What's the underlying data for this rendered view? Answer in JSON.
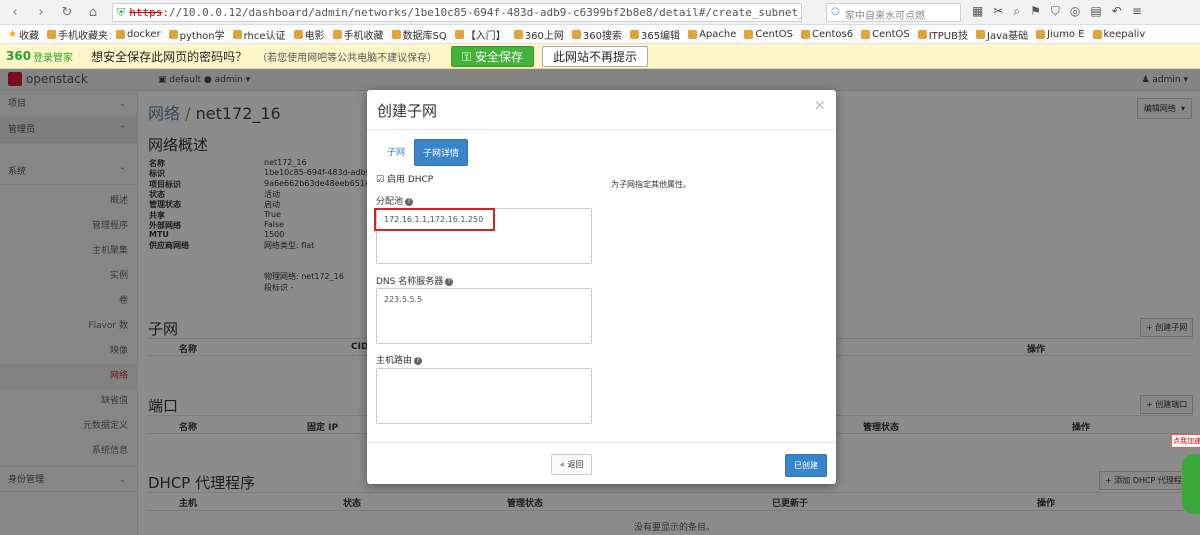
{
  "browser": {
    "url_https": "https",
    "url_rest": "://10.0.0.12/dashboard/admin/networks/1be10c85-694f-483d-adb9-c6399bf2b8e8/detail#/create_subnet__createsubnetdetail",
    "search_placeholder": "家中自来水可点燃"
  },
  "bookmarks": [
    "收藏",
    "手机收藏夹",
    "docker",
    "python学",
    "rhce认证",
    "电影",
    "手机收藏",
    "数据库SQ",
    "【入门】",
    "360上网",
    "360搜索",
    "365编辑",
    "Apache",
    "CentOS",
    "Centos6",
    "CentOS",
    "ITPUB技",
    "Java基础",
    "Jiumo E",
    "keepaliv"
  ],
  "pwbar": {
    "logo": "360",
    "logo_sub": "登录管家",
    "question": "想安全保存此网页的密码吗？",
    "note": "（若您使用网吧等公共电脑不建议保存）",
    "save": "安全保存",
    "no_prompt": "此网站不再提示"
  },
  "topbar": {
    "logo": "openstack",
    "project": "default ● admin ▾",
    "user": "admin ▾"
  },
  "sidebar": {
    "project": "项目",
    "admin": "管理员",
    "system": "系统",
    "items": [
      "概述",
      "管理程序",
      "主机聚集",
      "实例",
      "卷",
      "Flavor 数",
      "映像",
      "网络",
      "缺省值",
      "元数据定义",
      "系统信息"
    ],
    "identity": "身份管理"
  },
  "main": {
    "crumb_root": "网络",
    "crumb_sep": " / ",
    "crumb_leaf": "net172_16",
    "overview_title": "网络概述",
    "edit_network": "编辑网络",
    "overview": [
      {
        "k": "名称",
        "v": "net172_16"
      },
      {
        "k": "标识",
        "v": "1be10c85-694f-483d-adb9"
      },
      {
        "k": "项目标识",
        "v": "9a6e662b63de48eeb651a3"
      },
      {
        "k": "状态",
        "v": "活动"
      },
      {
        "k": "管理状态",
        "v": "启动"
      },
      {
        "k": "共享",
        "v": "True"
      },
      {
        "k": "外部网络",
        "v": "False"
      },
      {
        "k": "MTU",
        "v": "1500"
      },
      {
        "k": "供应商网络",
        "v": "网络类型:  flat"
      }
    ],
    "provider_extra": [
      "物理网络:  net172_16",
      "段标识 -"
    ],
    "subnet_title": "子网",
    "subnet_headers": [
      "名称",
      "CID",
      "操作"
    ],
    "create_subnet": "+ 创建子网",
    "port_title": "端口",
    "port_headers": [
      "名称",
      "固定 IP",
      "管理状态",
      "操作"
    ],
    "create_port": "+ 创建端口",
    "dhcp_title": "DHCP 代理程序",
    "dhcp_headers": [
      "主机",
      "状态",
      "管理状态",
      "已更新于",
      "操作"
    ],
    "add_dhcp": "+ 添加 DHCP 代理程序",
    "empty": "没有要显示的条目。"
  },
  "modal": {
    "title": "创建子网",
    "close": "×",
    "tab_subnet": "子网",
    "tab_detail": "子网详情",
    "dhcp_check": "☑",
    "dhcp_label": "启用 DHCP",
    "pool_label": "分配池",
    "pool_value": "172.16.1.1,172.16.1.250",
    "dns_label": "DNS 名称服务器",
    "dns_value": "223.5.5.5",
    "route_label": "主机路由",
    "route_value": "",
    "help_text": "为子网指定其他属性。",
    "back": "« 返回",
    "create": "已创建"
  },
  "ad": {
    "tag": "点我加速"
  }
}
